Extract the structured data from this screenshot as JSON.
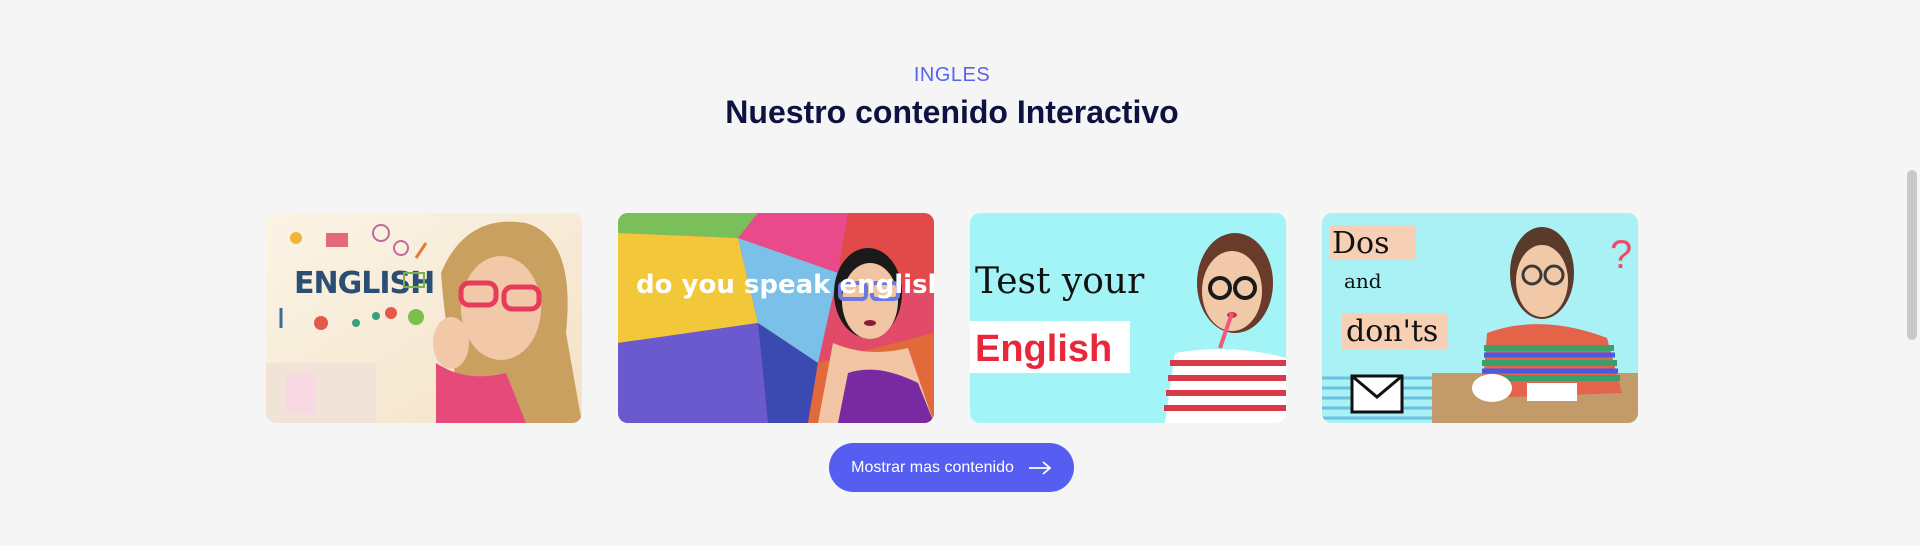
{
  "section": {
    "label": "INGLES",
    "title": "Nuestro contenido Interactivo"
  },
  "cards": [
    {
      "image_text": "ENGLISH",
      "icon": "english-learner-thumbnail"
    },
    {
      "image_text": "do you speak english?",
      "icon": "do-you-speak-english-thumbnail"
    },
    {
      "image_text_1": "Test your",
      "image_text_2": "English",
      "icon": "test-your-english-thumbnail"
    },
    {
      "image_text_1": "Dos",
      "image_text_2": "and",
      "image_text_3": "don'ts",
      "image_text_4": "?",
      "icon": "dos-and-donts-thumbnail"
    }
  ],
  "more_button": {
    "label": "Mostrar mas contenido",
    "icon": "arrow-right-icon"
  },
  "colors": {
    "background": "#f5f5f5",
    "accent": "#555ef0",
    "label": "#5a63ea",
    "title": "#0d1240"
  }
}
